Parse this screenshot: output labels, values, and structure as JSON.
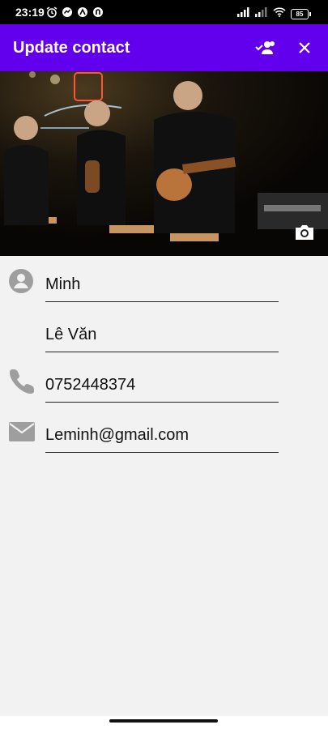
{
  "status_bar": {
    "time": "23:19",
    "battery": "85",
    "icons": [
      "alarm-icon",
      "messenger-icon",
      "app-icon",
      "vpn-icon",
      "signal-icon",
      "signal-icon",
      "wifi-icon",
      "battery-icon"
    ]
  },
  "app_bar": {
    "title": "Update contact",
    "actions": [
      "contacts-group-icon",
      "close-icon"
    ],
    "background": "#6200ee"
  },
  "photo": {
    "description_icon": "camera-icon"
  },
  "form": {
    "first_name": "Minh",
    "last_name": "Lê Văn",
    "phone": "0752448374",
    "email": "Leminh@gmail.com"
  }
}
